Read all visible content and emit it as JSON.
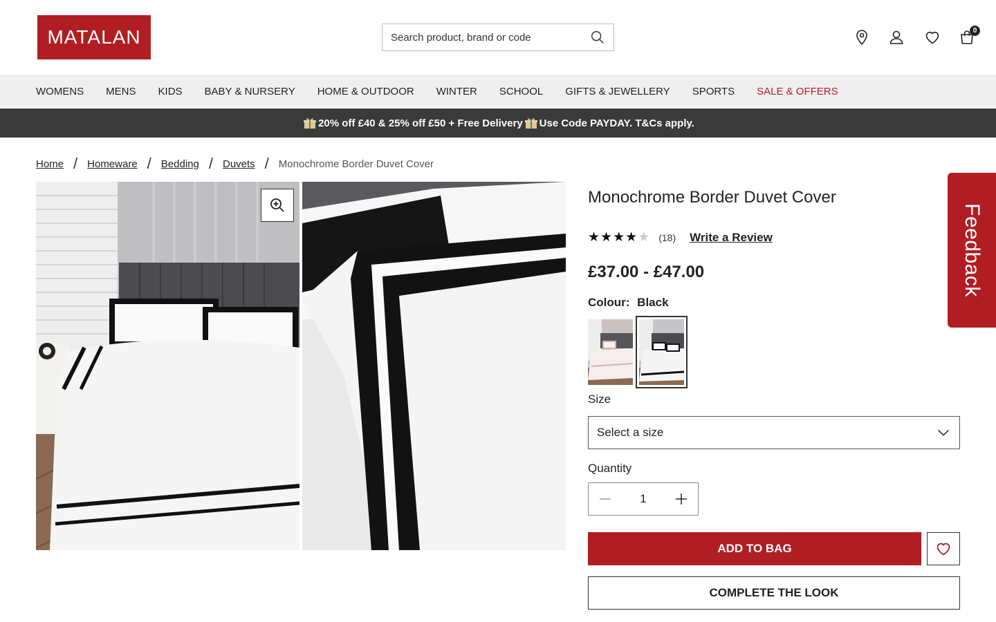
{
  "header": {
    "logo_text": "MATALAN",
    "search_placeholder": "Search product, brand or code",
    "bag_count": "0",
    "icons": [
      "search-icon",
      "location-pin-icon",
      "account-icon",
      "heart-icon",
      "bag-icon"
    ]
  },
  "nav": {
    "items": [
      "WOMENS",
      "MENS",
      "KIDS",
      "BABY & NURSERY",
      "HOME & OUTDOOR",
      "WINTER",
      "SCHOOL",
      "GIFTS & JEWELLERY",
      "SPORTS",
      "SALE & OFFERS"
    ]
  },
  "promo": {
    "text_a": "20% off £40 & 25% off £50 + Free Delivery ",
    "text_b": "Use Code PAYDAY. T&Cs apply."
  },
  "breadcrumb": {
    "items": [
      "Home",
      "Homeware",
      "Bedding",
      "Duvets"
    ],
    "current": "Monochrome Border Duvet Cover"
  },
  "product": {
    "title": "Monochrome Border Duvet Cover",
    "rating": 4,
    "rating_max": 5,
    "review_count": "(18)",
    "write_review": "Write a Review",
    "price": "£37.00 - £47.00",
    "colour_label": "Colour:",
    "colour_value": "Black",
    "size_label": "Size",
    "size_placeholder": "Select a size",
    "quantity_label": "Quantity",
    "quantity": "1",
    "add_to_bag": "ADD TO BAG",
    "complete_look": "COMPLETE THE LOOK"
  },
  "feedback_tab": "Feedback",
  "colors": {
    "brand_red": "#b01e23",
    "nav_bg": "#efefef",
    "promo_bg": "#3a3a3a"
  }
}
